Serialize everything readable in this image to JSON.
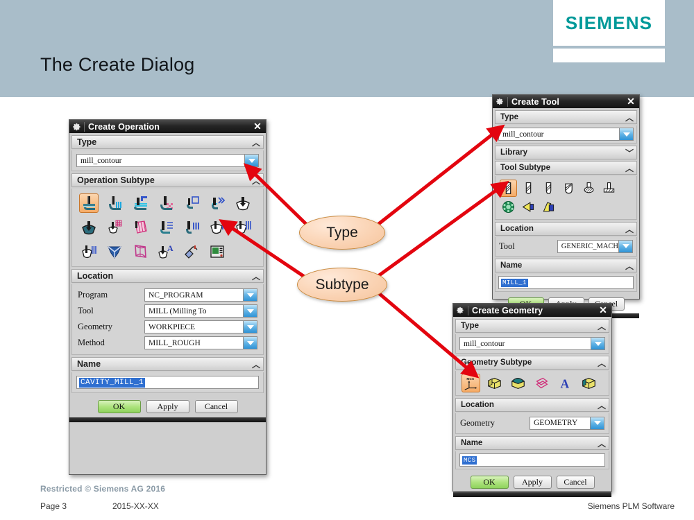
{
  "slide": {
    "title": "The Create Dialog",
    "logo": "SIEMENS"
  },
  "footer": {
    "restricted": "Restricted © Siemens AG 2016",
    "page": "Page 3",
    "date": "2015-XX-XX",
    "company": "Siemens PLM Software"
  },
  "callouts": {
    "type": "Type",
    "subtype": "Subtype"
  },
  "create_operation": {
    "title": "Create Operation",
    "close": "✕",
    "sections": {
      "type": "Type",
      "subtype": "Operation Subtype",
      "location": "Location",
      "name": "Name"
    },
    "type_value": "mill_contour",
    "location_rows": [
      {
        "label": "Program",
        "value": "NC_PROGRAM"
      },
      {
        "label": "Tool",
        "value": "MILL (Milling To"
      },
      {
        "label": "Geometry",
        "value": "WORKPIECE"
      },
      {
        "label": "Method",
        "value": "MILL_ROUGH"
      }
    ],
    "name_value": "CAVITY_MILL_1",
    "buttons": {
      "ok": "OK",
      "apply": "Apply",
      "cancel": "Cancel"
    },
    "subtype_icons": [
      "cavity-mill-icon",
      "plunge-milling-icon",
      "corner-rough-icon",
      "rest-milling-icon",
      "zlevel-profile-icon",
      "zlevel-corner-icon",
      "fixed-contour-icon",
      "contour-area-icon",
      "contour-surface-area-icon",
      "streamline-icon",
      "contour-area-nonsteep-icon",
      "contour-area-dir-steep-icon",
      "flowcut-single-icon",
      "flowcut-multiple-icon",
      "flowcut-ref-tool-icon",
      "solid-profile-3d-icon",
      "profile-3d-icon",
      "contour-text-icon",
      "mill-user-defined-icon",
      "mill-control-icon"
    ]
  },
  "create_tool": {
    "title": "Create Tool",
    "close": "✕",
    "sections": {
      "type": "Type",
      "library": "Library",
      "subtype": "Tool Subtype",
      "location": "Location",
      "name": "Name"
    },
    "type_value": "mill_contour",
    "location_rows": [
      {
        "label": "Tool",
        "value": "GENERIC_MACH"
      }
    ],
    "name_value": "MILL_1",
    "buttons": {
      "ok": "OK",
      "apply": "Apply",
      "cancel": "Cancel"
    },
    "subtype_icons": [
      "mill-5-param-icon",
      "mill-7-param-icon",
      "mill-10-param-icon",
      "ball-mill-icon",
      "chamfer-mill-icon",
      "t-cutter-icon",
      "barrel-tool-icon",
      "mill-form-icon",
      "thread-mill-icon"
    ]
  },
  "create_geometry": {
    "title": "Create Geometry",
    "close": "✕",
    "sections": {
      "type": "Type",
      "subtype": "Geometry Subtype",
      "location": "Location",
      "name": "Name"
    },
    "type_value": "mill_contour",
    "location_rows": [
      {
        "label": "Geometry",
        "value": "GEOMETRY"
      }
    ],
    "name_value": "MCS",
    "buttons": {
      "ok": "OK",
      "apply": "Apply",
      "cancel": "Cancel"
    },
    "subtype_icons": [
      "mcs-icon",
      "workpiece-icon",
      "mill-area-icon",
      "mill-bnd-icon",
      "mill-text-icon",
      "mill-geom-icon"
    ]
  },
  "colors": {
    "header_bg": "#a9bdc9",
    "siemens_teal": "#009999",
    "arrow_red": "#e3050f",
    "bubble_fill": "#f6c49c",
    "bubble_stroke": "#c98b41",
    "ok_green": "#8ed25c",
    "selection_blue": "#2f6fd0"
  }
}
